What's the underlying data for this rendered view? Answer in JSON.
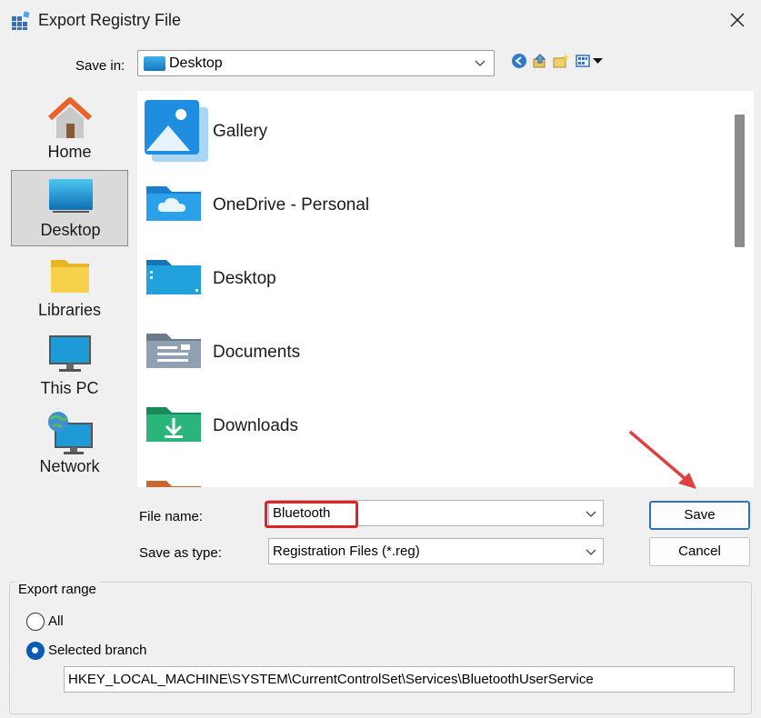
{
  "window": {
    "title": "Export Registry File"
  },
  "save_in": {
    "label": "Save in:",
    "value": "Desktop"
  },
  "toolbar": {
    "icons": [
      "back-icon",
      "up-folder-icon",
      "new-folder-icon",
      "view-menu-icon"
    ]
  },
  "places": [
    {
      "label": "Home",
      "icon": "home-icon"
    },
    {
      "label": "Desktop",
      "icon": "desktop-icon",
      "active": true
    },
    {
      "label": "Libraries",
      "icon": "libraries-icon"
    },
    {
      "label": "This PC",
      "icon": "this-pc-icon"
    },
    {
      "label": "Network",
      "icon": "network-icon"
    }
  ],
  "files": [
    {
      "name": "Gallery",
      "icon": "gallery-icon"
    },
    {
      "name": "OneDrive - Personal",
      "icon": "onedrive-folder-icon"
    },
    {
      "name": "Desktop",
      "icon": "desktop-folder-icon"
    },
    {
      "name": "Documents",
      "icon": "documents-folder-icon"
    },
    {
      "name": "Downloads",
      "icon": "downloads-folder-icon"
    }
  ],
  "file_name": {
    "label": "File name:",
    "value": "Bluetooth"
  },
  "save_as_type": {
    "label": "Save as type:",
    "value": "Registration Files (*.reg)"
  },
  "buttons": {
    "save": "Save",
    "cancel": "Cancel"
  },
  "export_range": {
    "title": "Export range",
    "options": [
      {
        "label": "All",
        "checked": false
      },
      {
        "label": "Selected branch",
        "checked": true
      }
    ],
    "branch": "HKEY_LOCAL_MACHINE\\SYSTEM\\CurrentControlSet\\Services\\BluetoothUserService"
  },
  "colors": {
    "accent": "#0a5bb5",
    "highlight": "#e02424",
    "arrow": "#e04040"
  }
}
